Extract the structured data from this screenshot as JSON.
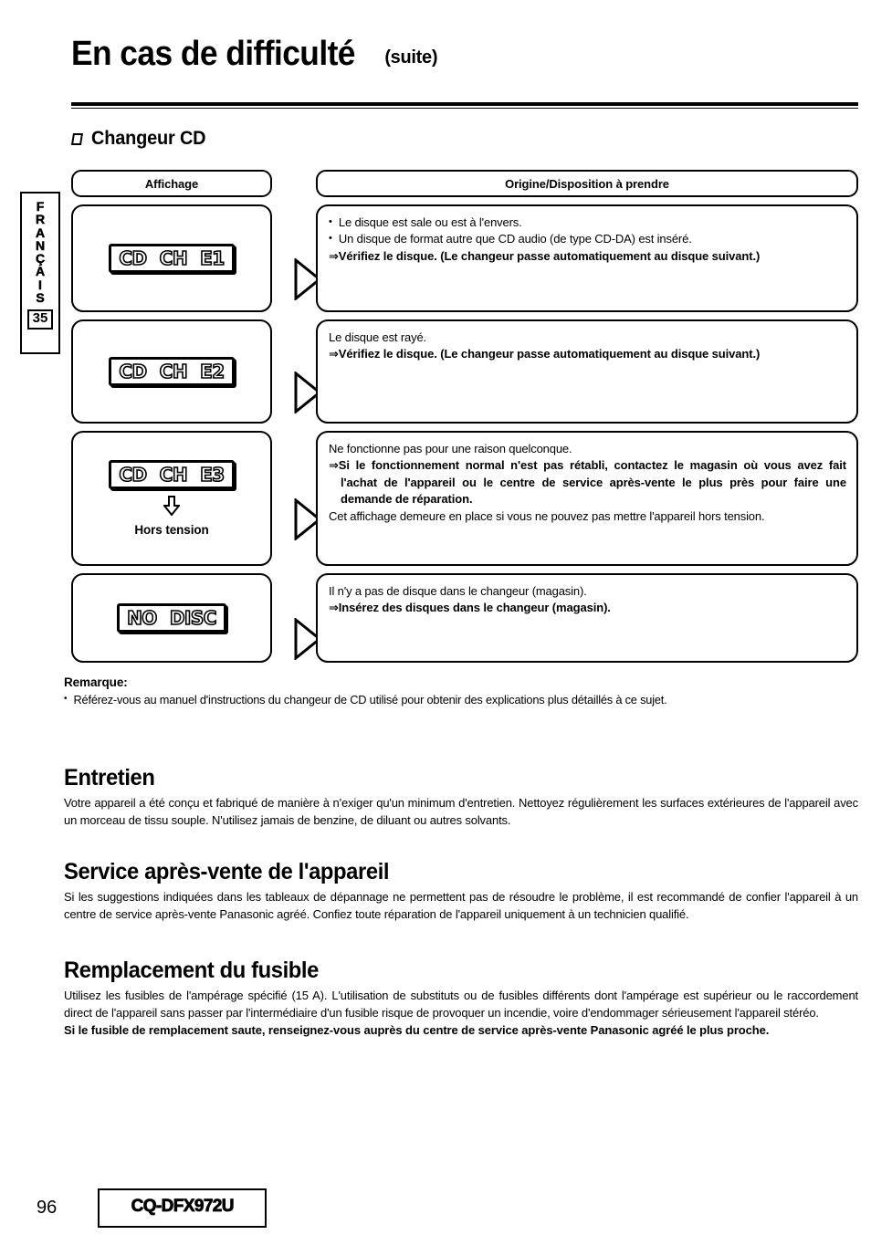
{
  "header": {
    "title_main": "En cas de difficulté",
    "title_suffix": "(suite)",
    "section_heading": "Changeur CD"
  },
  "side_tab": {
    "language": "FRANÇAIS",
    "letters": [
      "F",
      "R",
      "A",
      "N",
      "Ç",
      "A",
      "I",
      "S"
    ],
    "page_label": "35"
  },
  "table": {
    "headers": {
      "display": "Affichage",
      "cause": "Origine/Disposition à prendre"
    },
    "rows": [
      {
        "display_segments": [
          "CD",
          "CH",
          "E1"
        ],
        "note": "",
        "lines": [
          {
            "style": "bullet",
            "text": "Le disque est sale ou est à l'envers."
          },
          {
            "style": "bullet",
            "text": "Un disque de format autre que CD audio (de type CD-DA) est inséré."
          },
          {
            "style": "arrow-bold",
            "text": "Vérifiez le disque. (Le changeur passe automatiquement au disque suivant.)"
          }
        ]
      },
      {
        "display_segments": [
          "CD",
          "CH",
          "E2"
        ],
        "note": "",
        "lines": [
          {
            "style": "plain",
            "text": "Le disque est rayé."
          },
          {
            "style": "arrow-bold",
            "text": "Vérifiez le disque. (Le changeur passe automatiquement au disque suivant.)"
          }
        ]
      },
      {
        "display_segments": [
          "CD",
          "CH",
          "E3"
        ],
        "note": "Hors tension",
        "lines": [
          {
            "style": "plain",
            "text": "Ne fonctionne pas pour une raison quelconque."
          },
          {
            "style": "arrow-bold",
            "text": "Si le fonctionnement normal n'est pas rétabli, contactez le magasin où vous avez fait l'achat de l'appareil ou le centre de service après-vente le plus près pour faire une demande de réparation."
          },
          {
            "style": "plain",
            "text": "Cet affichage demeure en place si vous ne pouvez pas mettre l'appareil hors tension."
          }
        ]
      },
      {
        "display_segments": [
          "NO",
          "DISC"
        ],
        "note": "",
        "lines": [
          {
            "style": "plain",
            "text": "Il n'y a pas de disque dans le changeur (magasin)."
          },
          {
            "style": "arrow-bold",
            "text": "Insérez des disques dans le changeur (magasin)."
          }
        ]
      }
    ]
  },
  "remarque": {
    "title": "Remarque:",
    "items": [
      "Référez-vous au manuel d'instructions du changeur de CD utilisé pour obtenir des explications plus détaillés à ce sujet."
    ]
  },
  "sections": [
    {
      "heading": "Entretien",
      "paragraphs": [
        {
          "bold": false,
          "text": "Votre appareil a été conçu et fabriqué de manière à n'exiger qu'un minimum d'entretien. Nettoyez régulièrement les surfaces extérieures de l'appareil avec un morceau de tissu souple. N'utilisez jamais de benzine, de diluant ou autres solvants."
        }
      ]
    },
    {
      "heading": "Service après-vente de l'appareil",
      "paragraphs": [
        {
          "bold": false,
          "text": "Si les suggestions indiquées dans les tableaux de dépannage ne permettent pas de résoudre le problème, il est recommandé de confier l'appareil à un centre de service après-vente Panasonic agréé. Confiez toute réparation de l'appareil uniquement à un technicien qualifié."
        }
      ]
    },
    {
      "heading": "Remplacement du fusible",
      "paragraphs": [
        {
          "bold": false,
          "text": "Utilisez les fusibles de l'ampérage spécifié (15 A). L'utilisation de substituts ou de fusibles différents dont l'ampérage est supérieur ou le raccordement direct de l'appareil sans passer par l'intermédiaire d'un fusible risque de provoquer un incendie, voire d'endommager sérieusement l'appareil stéréo."
        },
        {
          "bold": true,
          "text": "Si le fusible de remplacement saute, renseignez-vous auprès du centre de service après-vente Panasonic agréé le plus proche."
        }
      ]
    }
  ],
  "footer": {
    "page_number": "96",
    "model": "CQ-DFX972U"
  },
  "icons": {
    "bullet": "•",
    "arrow_right": "⇒",
    "arrow_down": "⇩"
  },
  "colors": {
    "ink": "#000000",
    "paper": "#ffffff"
  }
}
